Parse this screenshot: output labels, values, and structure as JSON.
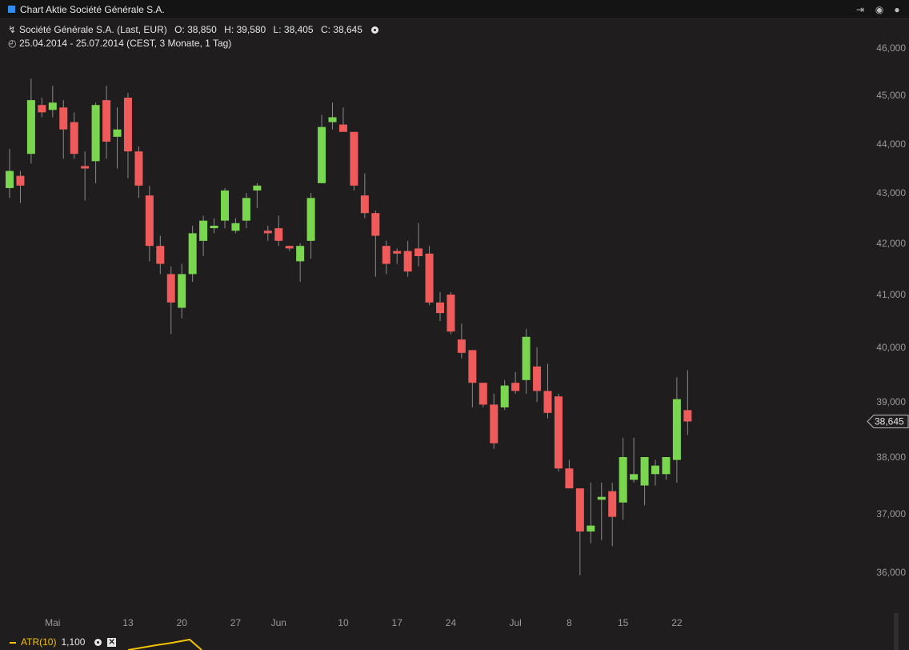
{
  "window": {
    "title": "Chart Aktie Société Générale S.A.",
    "controls": [
      "export-icon",
      "settings-icon",
      "close-icon"
    ]
  },
  "header": {
    "instrument": "Société Générale S.A. (Last, EUR)",
    "open": "O: 38,850",
    "high": "H: 39,580",
    "low": "L: 38,405",
    "close": "C: 38,645",
    "range": "25.04.2014 - 25.07.2014 (CEST, 3 Monate, 1 Tag)"
  },
  "indicator": {
    "name": "ATR(10)",
    "value": "1,100"
  },
  "last_price_label": "38,645",
  "colors": {
    "background": "#1f1d1d",
    "up": "#7bd64f",
    "down": "#ef5b5b",
    "wick": "#8a8a8a",
    "atr": "#f2c200"
  },
  "chart_data": {
    "type": "candlestick",
    "ylim": [
      35.8,
      46.3
    ],
    "y_ticks": [
      "36,000",
      "37,000",
      "38,000",
      "39,000",
      "40,000",
      "41,000",
      "42,000",
      "43,000",
      "44,000",
      "45,000",
      "46,000"
    ],
    "y_tick_values": [
      36,
      37,
      38,
      39,
      40,
      41,
      42,
      43,
      44,
      45,
      46
    ],
    "x_labels": [
      {
        "label": "Mai",
        "index": 4
      },
      {
        "label": "13",
        "index": 11
      },
      {
        "label": "20",
        "index": 16
      },
      {
        "label": "27",
        "index": 21
      },
      {
        "label": "Jun",
        "index": 25
      },
      {
        "label": "10",
        "index": 31
      },
      {
        "label": "17",
        "index": 36
      },
      {
        "label": "24",
        "index": 41
      },
      {
        "label": "Jul",
        "index": 47
      },
      {
        "label": "8",
        "index": 52
      },
      {
        "label": "15",
        "index": 57
      },
      {
        "label": "22",
        "index": 62
      }
    ],
    "candles": [
      {
        "o": 43.1,
        "h": 43.9,
        "l": 42.9,
        "c": 43.45
      },
      {
        "o": 43.35,
        "h": 43.45,
        "l": 42.8,
        "c": 43.15
      },
      {
        "o": 43.8,
        "h": 45.35,
        "l": 43.6,
        "c": 44.9
      },
      {
        "o": 44.8,
        "h": 44.95,
        "l": 44.55,
        "c": 44.65
      },
      {
        "o": 44.7,
        "h": 45.2,
        "l": 44.55,
        "c": 44.85
      },
      {
        "o": 44.75,
        "h": 44.9,
        "l": 43.7,
        "c": 44.3
      },
      {
        "o": 44.45,
        "h": 44.65,
        "l": 43.7,
        "c": 43.8
      },
      {
        "o": 43.55,
        "h": 43.85,
        "l": 42.85,
        "c": 43.5
      },
      {
        "o": 43.65,
        "h": 44.85,
        "l": 43.2,
        "c": 44.8
      },
      {
        "o": 44.9,
        "h": 45.2,
        "l": 43.7,
        "c": 44.05
      },
      {
        "o": 44.15,
        "h": 44.75,
        "l": 43.5,
        "c": 44.3
      },
      {
        "o": 44.95,
        "h": 45.05,
        "l": 43.3,
        "c": 43.85
      },
      {
        "o": 43.85,
        "h": 43.95,
        "l": 42.9,
        "c": 43.15
      },
      {
        "o": 42.95,
        "h": 43.15,
        "l": 41.65,
        "c": 41.95
      },
      {
        "o": 41.95,
        "h": 42.15,
        "l": 41.4,
        "c": 41.6
      },
      {
        "o": 41.4,
        "h": 41.55,
        "l": 40.25,
        "c": 40.85
      },
      {
        "o": 40.75,
        "h": 41.6,
        "l": 40.55,
        "c": 41.4
      },
      {
        "o": 41.4,
        "h": 42.35,
        "l": 41.25,
        "c": 42.2
      },
      {
        "o": 42.05,
        "h": 42.55,
        "l": 41.75,
        "c": 42.45
      },
      {
        "o": 42.3,
        "h": 42.5,
        "l": 42.2,
        "c": 42.35
      },
      {
        "o": 42.45,
        "h": 43.1,
        "l": 42.3,
        "c": 43.05
      },
      {
        "o": 42.25,
        "h": 42.5,
        "l": 42.2,
        "c": 42.4
      },
      {
        "o": 42.45,
        "h": 43.0,
        "l": 42.3,
        "c": 42.9
      },
      {
        "o": 43.05,
        "h": 43.2,
        "l": 42.7,
        "c": 43.15
      },
      {
        "o": 42.25,
        "h": 42.35,
        "l": 42.05,
        "c": 42.2
      },
      {
        "o": 42.3,
        "h": 42.55,
        "l": 41.95,
        "c": 42.05
      },
      {
        "o": 41.95,
        "h": 41.95,
        "l": 41.85,
        "c": 41.9
      },
      {
        "o": 41.65,
        "h": 42.0,
        "l": 41.25,
        "c": 41.95
      },
      {
        "o": 42.05,
        "h": 43.0,
        "l": 41.7,
        "c": 42.9
      },
      {
        "o": 43.2,
        "h": 44.6,
        "l": 43.2,
        "c": 44.35
      },
      {
        "o": 44.45,
        "h": 44.85,
        "l": 44.3,
        "c": 44.55
      },
      {
        "o": 44.4,
        "h": 44.75,
        "l": 44.3,
        "c": 44.25
      },
      {
        "o": 44.25,
        "h": 44.25,
        "l": 43.05,
        "c": 43.15
      },
      {
        "o": 42.95,
        "h": 43.4,
        "l": 42.5,
        "c": 42.6
      },
      {
        "o": 42.6,
        "h": 42.65,
        "l": 41.35,
        "c": 42.15
      },
      {
        "o": 41.95,
        "h": 42.05,
        "l": 41.4,
        "c": 41.6
      },
      {
        "o": 41.85,
        "h": 41.9,
        "l": 41.6,
        "c": 41.8
      },
      {
        "o": 41.85,
        "h": 42.05,
        "l": 41.35,
        "c": 41.45
      },
      {
        "o": 41.9,
        "h": 42.4,
        "l": 41.55,
        "c": 41.75
      },
      {
        "o": 41.8,
        "h": 41.95,
        "l": 40.8,
        "c": 40.85
      },
      {
        "o": 40.85,
        "h": 41.05,
        "l": 40.5,
        "c": 40.65
      },
      {
        "o": 41.0,
        "h": 41.05,
        "l": 40.25,
        "c": 40.3
      },
      {
        "o": 40.15,
        "h": 40.45,
        "l": 39.8,
        "c": 39.9
      },
      {
        "o": 39.95,
        "h": 39.95,
        "l": 38.9,
        "c": 39.35
      },
      {
        "o": 39.35,
        "h": 39.35,
        "l": 38.9,
        "c": 38.95
      },
      {
        "o": 38.95,
        "h": 39.15,
        "l": 38.15,
        "c": 38.25
      },
      {
        "o": 38.9,
        "h": 39.4,
        "l": 38.85,
        "c": 39.3
      },
      {
        "o": 39.35,
        "h": 39.55,
        "l": 39.15,
        "c": 39.2
      },
      {
        "o": 39.4,
        "h": 40.35,
        "l": 39.15,
        "c": 40.2
      },
      {
        "o": 39.65,
        "h": 40.0,
        "l": 39.0,
        "c": 39.2
      },
      {
        "o": 39.2,
        "h": 39.7,
        "l": 38.7,
        "c": 38.8
      },
      {
        "o": 39.1,
        "h": 39.15,
        "l": 37.75,
        "c": 37.8
      },
      {
        "o": 37.8,
        "h": 37.95,
        "l": 37.45,
        "c": 37.45
      },
      {
        "o": 37.45,
        "h": 37.45,
        "l": 35.95,
        "c": 36.7
      },
      {
        "o": 36.7,
        "h": 37.55,
        "l": 36.5,
        "c": 36.8
      },
      {
        "o": 37.25,
        "h": 37.55,
        "l": 36.55,
        "c": 37.3
      },
      {
        "o": 37.4,
        "h": 37.55,
        "l": 36.45,
        "c": 36.95
      },
      {
        "o": 37.2,
        "h": 38.35,
        "l": 36.9,
        "c": 38.0
      },
      {
        "o": 37.6,
        "h": 38.35,
        "l": 37.55,
        "c": 37.7
      },
      {
        "o": 37.5,
        "h": 38.0,
        "l": 37.15,
        "c": 38.0
      },
      {
        "o": 37.7,
        "h": 37.95,
        "l": 37.5,
        "c": 37.85
      },
      {
        "o": 37.7,
        "h": 38.0,
        "l": 37.6,
        "c": 38.0
      },
      {
        "o": 37.95,
        "h": 39.45,
        "l": 37.55,
        "c": 39.05
      },
      {
        "o": 38.85,
        "h": 39.58,
        "l": 38.4,
        "c": 38.645
      }
    ]
  }
}
